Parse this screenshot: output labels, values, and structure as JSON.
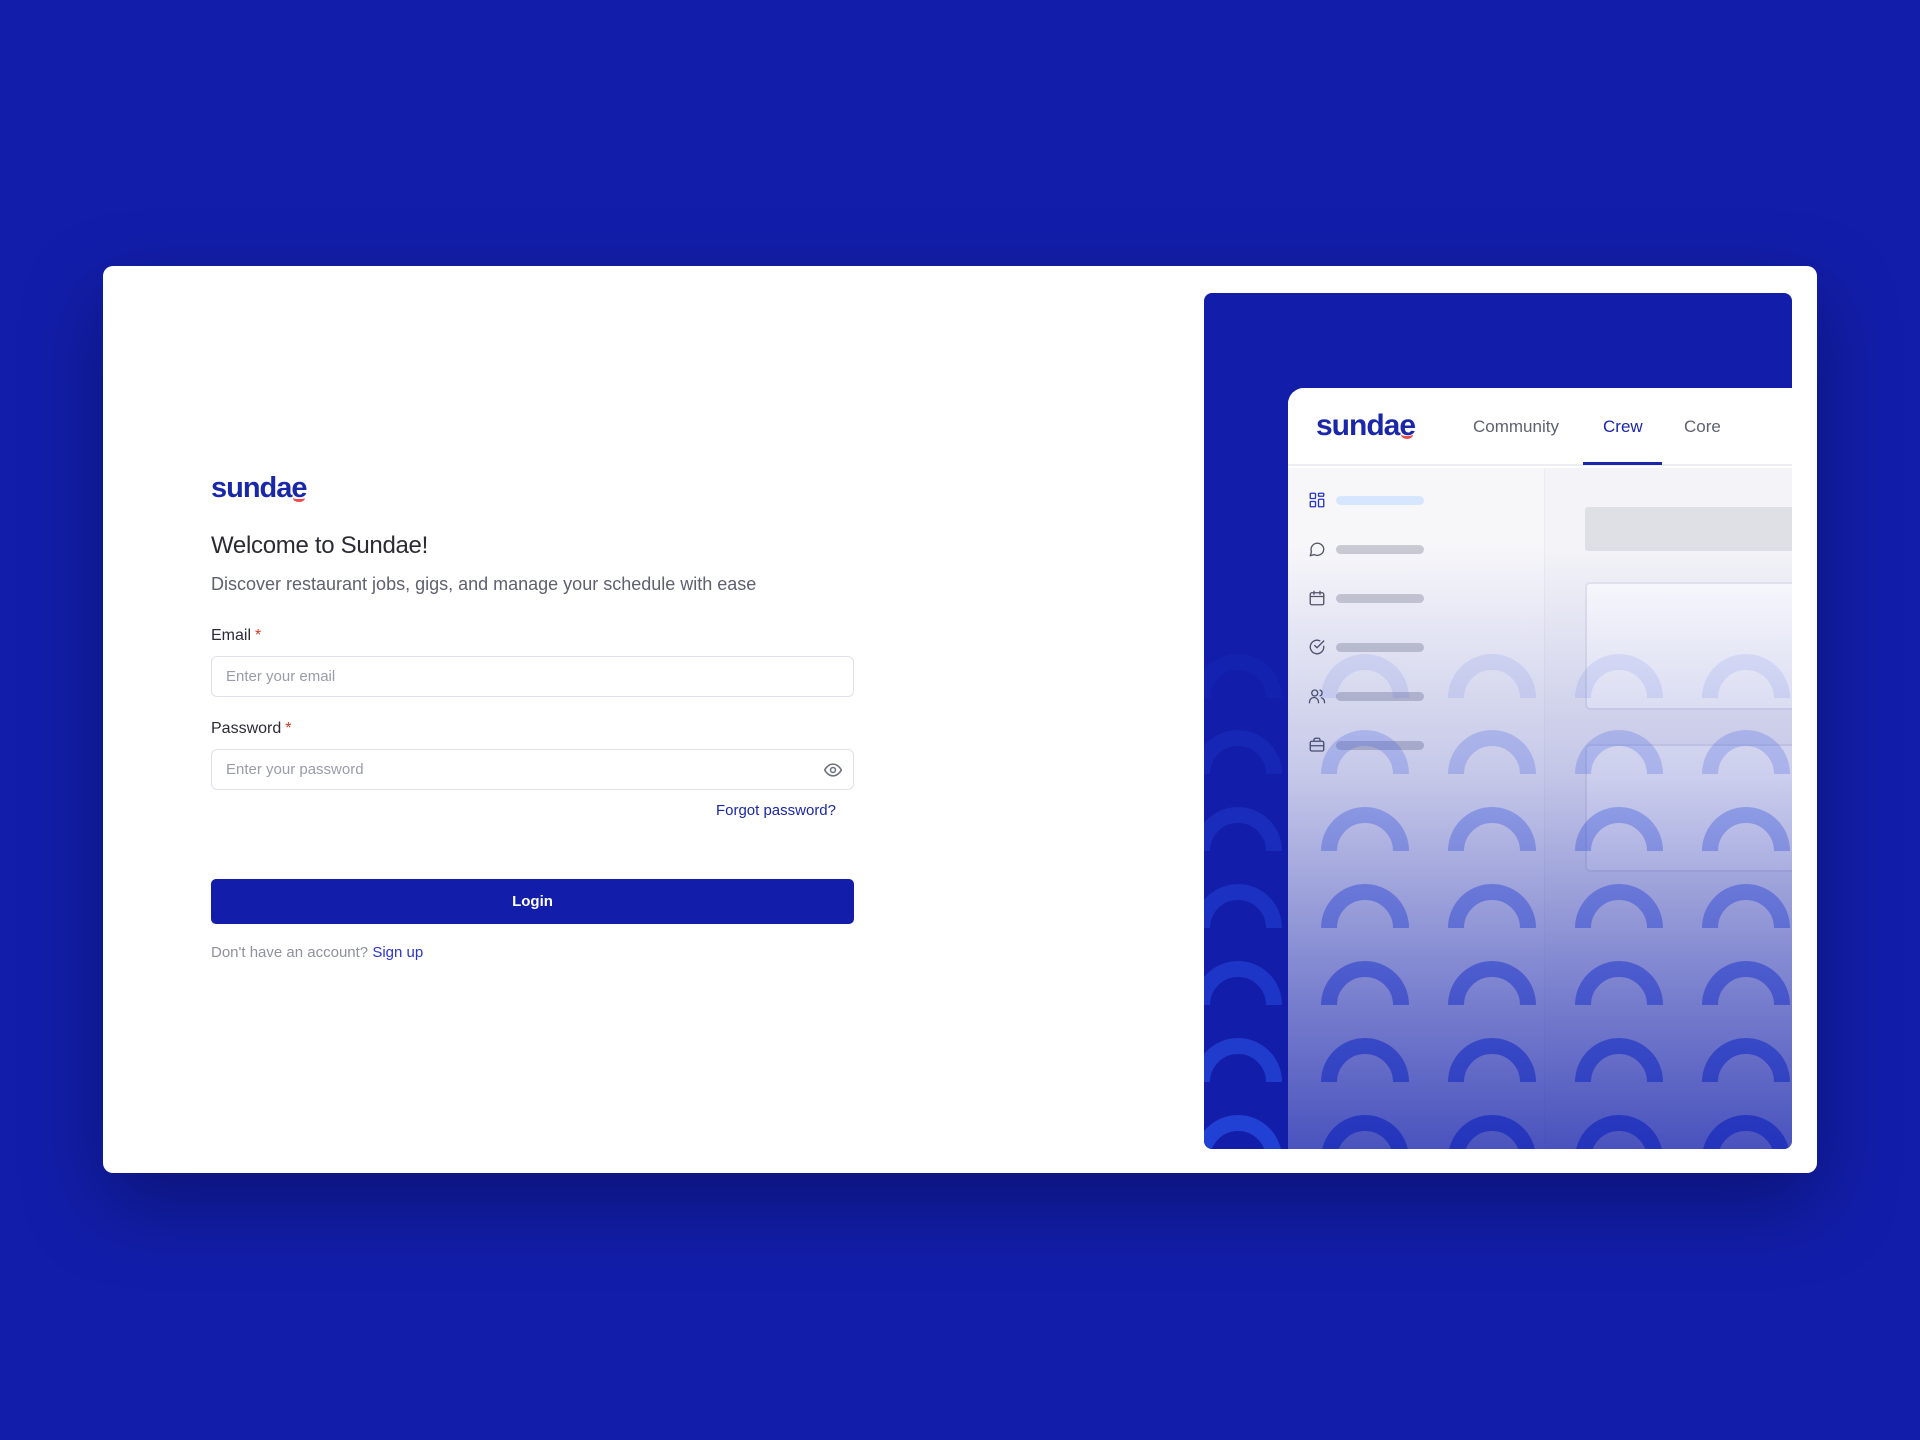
{
  "brand": {
    "logo_main": "sundae",
    "accent_color": "#121eaa",
    "smile_color": "#ee4b4b"
  },
  "form": {
    "title": "Welcome to Sundae!",
    "subtitle": "Discover restaurant jobs, gigs, and manage your schedule with ease",
    "email_label": "Email",
    "email_placeholder": "Enter your email",
    "password_label": "Password",
    "password_placeholder": "Enter your password",
    "required_mark": "*",
    "forgot_password": "Forgot password?",
    "login_button": "Login",
    "no_account_text": "Don't have an account?",
    "signup_link": "Sign up",
    "password_toggle_icon": "eye-icon"
  },
  "preview": {
    "tabs": [
      {
        "label": "Community",
        "active": false
      },
      {
        "label": "Crew",
        "active": true
      },
      {
        "label": "Core",
        "active": false
      }
    ],
    "sidebar_icons": [
      "dashboard-icon",
      "chat-icon",
      "calendar-icon",
      "check-circle-icon",
      "users-icon",
      "briefcase-icon"
    ]
  }
}
